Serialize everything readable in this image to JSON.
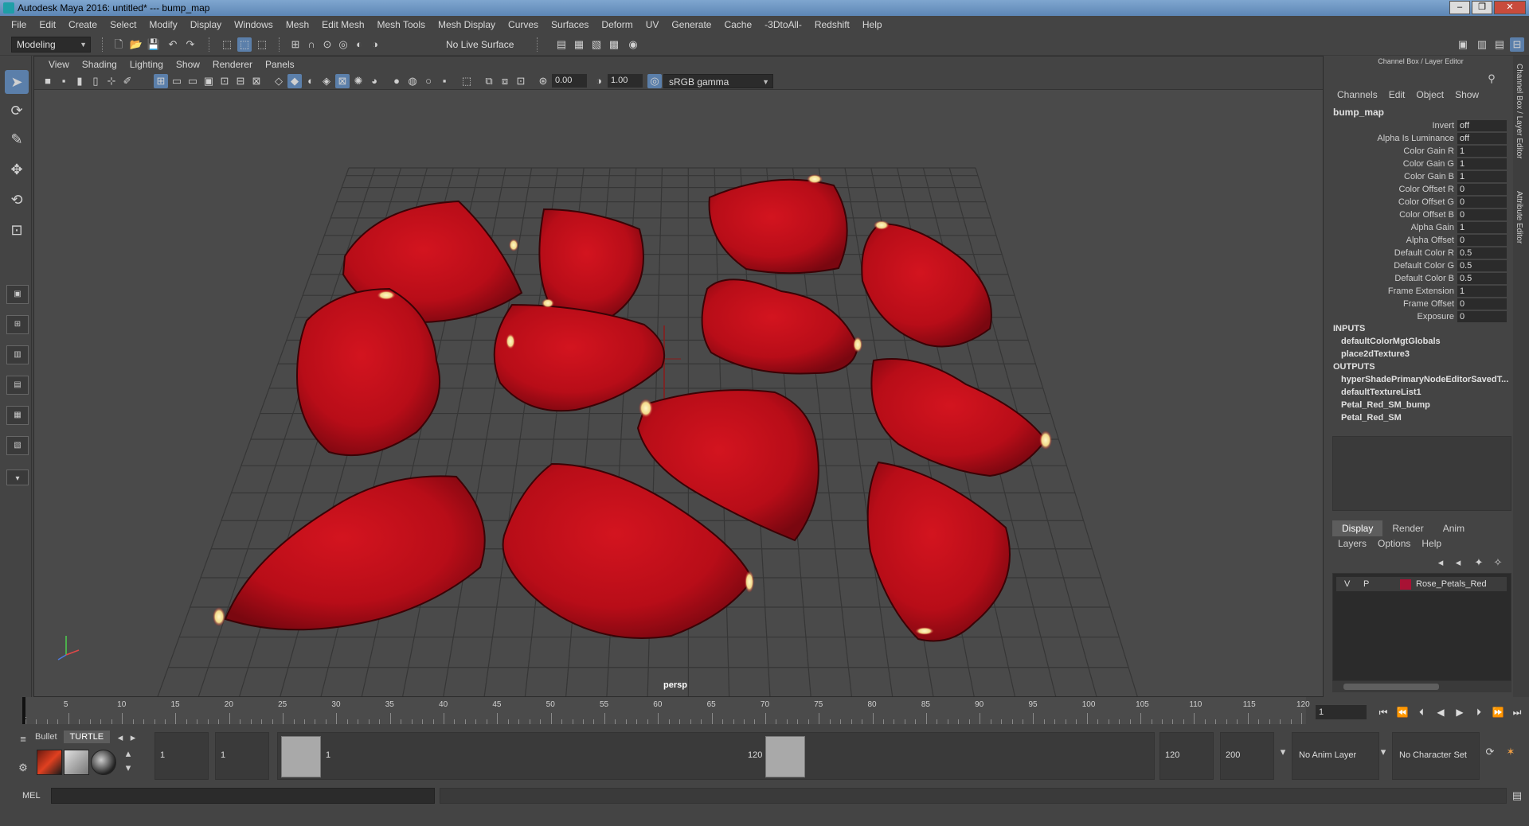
{
  "window": {
    "title": "Autodesk Maya 2016: untitled*   ---   bump_map",
    "buttons": [
      "–",
      "❐",
      "✕"
    ]
  },
  "menubar": [
    "File",
    "Edit",
    "Create",
    "Select",
    "Modify",
    "Display",
    "Windows",
    "Mesh",
    "Edit Mesh",
    "Mesh Tools",
    "Mesh Display",
    "Curves",
    "Surfaces",
    "Deform",
    "UV",
    "Generate",
    "Cache",
    "-3DtoAll-",
    "Redshift",
    "Help"
  ],
  "statusline": {
    "mode": "Modeling",
    "live_surface": "No Live Surface"
  },
  "viewport": {
    "menu": [
      "View",
      "Shading",
      "Lighting",
      "Show",
      "Renderer",
      "Panels"
    ],
    "exposure": "0.00",
    "gamma": "1.00",
    "color_space": "sRGB gamma",
    "camera_label": "persp"
  },
  "channel_box": {
    "title": "Channel Box / Layer Editor",
    "menu": [
      "Channels",
      "Edit",
      "Object",
      "Show"
    ],
    "node": "bump_map",
    "attributes": [
      {
        "label": "Invert",
        "value": "off"
      },
      {
        "label": "Alpha Is Luminance",
        "value": "off"
      },
      {
        "label": "Color Gain R",
        "value": "1"
      },
      {
        "label": "Color Gain G",
        "value": "1"
      },
      {
        "label": "Color Gain B",
        "value": "1"
      },
      {
        "label": "Color Offset R",
        "value": "0"
      },
      {
        "label": "Color Offset G",
        "value": "0"
      },
      {
        "label": "Color Offset B",
        "value": "0"
      },
      {
        "label": "Alpha Gain",
        "value": "1"
      },
      {
        "label": "Alpha Offset",
        "value": "0"
      },
      {
        "label": "Default Color R",
        "value": "0.5"
      },
      {
        "label": "Default Color G",
        "value": "0.5"
      },
      {
        "label": "Default Color B",
        "value": "0.5"
      },
      {
        "label": "Frame Extension",
        "value": "1"
      },
      {
        "label": "Frame Offset",
        "value": "0"
      },
      {
        "label": "Exposure",
        "value": "0"
      }
    ],
    "inputs_label": "INPUTS",
    "inputs": [
      "defaultColorMgtGlobals",
      "place2dTexture3"
    ],
    "outputs_label": "OUTPUTS",
    "outputs": [
      "hyperShadePrimaryNodeEditorSavedT...",
      "defaultTextureList1",
      "Petal_Red_SM_bump",
      "Petal_Red_SM"
    ]
  },
  "layer_editor": {
    "tabs": [
      "Display",
      "Render",
      "Anim"
    ],
    "menu": [
      "Layers",
      "Options",
      "Help"
    ],
    "layer": {
      "visible": "V",
      "playback": "P",
      "name": "Rose_Petals_Red",
      "color": "#a81234"
    }
  },
  "side_tabs": [
    "Channel Box / Layer Editor",
    "Attribute Editor"
  ],
  "timeline": {
    "ticks": [
      "5",
      "10",
      "15",
      "20",
      "25",
      "30",
      "35",
      "40",
      "45",
      "50",
      "55",
      "60",
      "65",
      "70",
      "75",
      "80",
      "85",
      "90",
      "95",
      "100",
      "105",
      "110",
      "115",
      "120"
    ],
    "start_tick": "1",
    "current_frame": "1"
  },
  "range": {
    "shelf_tabs": [
      "Bullet",
      "TURTLE"
    ],
    "start": "1",
    "min": "1",
    "range_start": "1",
    "range_end": "120",
    "end": "120",
    "max": "200",
    "anim_layer": "No Anim Layer",
    "character_set": "No Character Set"
  },
  "command_line": {
    "label": "MEL"
  },
  "colors": {
    "petal": "#c0101c",
    "accent": "#5b7faa"
  }
}
